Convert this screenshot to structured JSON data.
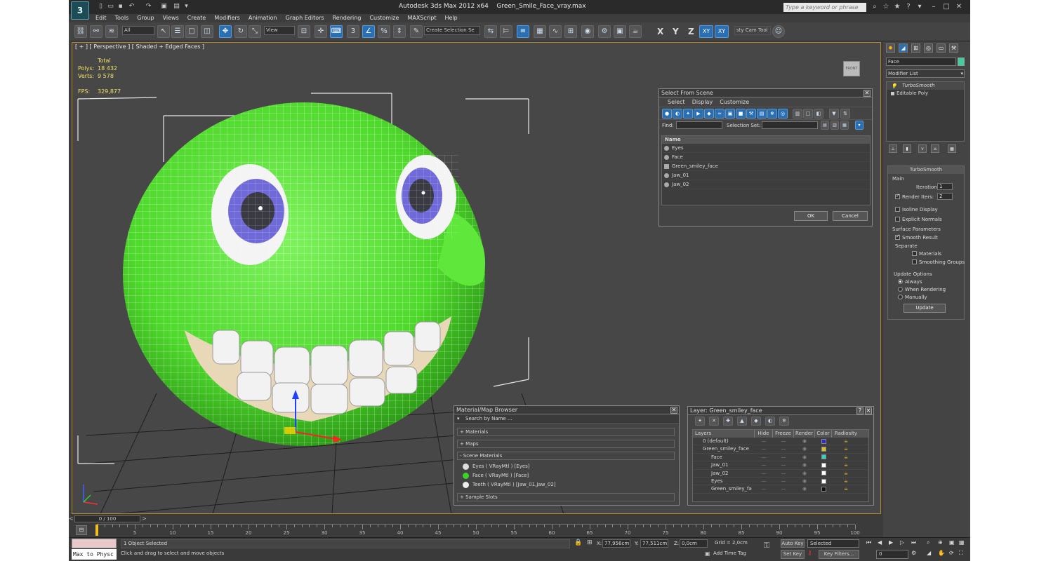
{
  "app": {
    "title": "Autodesk 3ds Max  2012 x64",
    "file": "Green_Smile_Face_vray.max",
    "search_placeholder": "Type a keyword or phrase",
    "logo": "3ds-max-logo"
  },
  "menu": [
    "Edit",
    "Tools",
    "Group",
    "Views",
    "Create",
    "Modifiers",
    "Animation",
    "Graph Editors",
    "Rendering",
    "Customize",
    "MAXScript",
    "Help"
  ],
  "toolbar": {
    "filter_value": "All",
    "view_value": "View",
    "selection_set_placeholder": "Create Selection Se",
    "axis_x": "X",
    "axis_y": "Y",
    "axis_z": "Z",
    "axis_xy": "XY",
    "axis_xy2": "XY",
    "cam_tool": "sty Cam Tool"
  },
  "viewport": {
    "label": "[ + ] [ Perspective ] [ Shaded + Edged Faces ]",
    "stats_total": "Total",
    "polys_label": "Polys:",
    "polys_value": "18 432",
    "verts_label": "Verts:",
    "verts_value": "9 578",
    "fps_label": "FPS:",
    "fps_value": "329,877",
    "viewcube_label": "FRONT"
  },
  "select_from_scene": {
    "title": "Select From Scene",
    "menu": [
      "Select",
      "Display",
      "Customize"
    ],
    "find_label": "Find:",
    "selection_set_label": "Selection Set:",
    "column_name": "Name",
    "items": [
      "Eyes",
      "Face",
      "Green_smiley_face",
      "Jaw_01",
      "Jaw_02"
    ],
    "ok": "OK",
    "cancel": "Cancel"
  },
  "material_browser": {
    "title": "Material/Map Browser",
    "search_placeholder": "Search by Name ...",
    "groups": [
      "+ Materials",
      "+ Maps",
      "- Scene Materials"
    ],
    "scene_materials": [
      "Eyes  ( VRayMtl ) [Eyes]",
      "Face  ( VRayMtl ) [Face]",
      "Teeth  ( VRayMtl ) [Jaw_01,Jaw_02]"
    ],
    "sample_slots": "+ Sample Slots"
  },
  "layer_dialog": {
    "title": "Layer: Green_smiley_face",
    "help": "?",
    "columns": [
      "Layers",
      "Hide",
      "Freeze",
      "Render",
      "Color",
      "Radiosity"
    ],
    "rows": [
      {
        "name": "0 (default)",
        "color": "#2c2ccc"
      },
      {
        "name": "Green_smiley_face",
        "color": "#d8c020"
      },
      {
        "name": "Face",
        "color": "#2ad8c8"
      },
      {
        "name": "Jaw_01",
        "color": "#ffffff"
      },
      {
        "name": "Jaw_02",
        "color": "#ffffff"
      },
      {
        "name": "Eyes",
        "color": "#ffffff"
      },
      {
        "name": "Green_smiley_fa",
        "color": "#111111"
      }
    ]
  },
  "command_panel": {
    "object_name": "Face",
    "object_color": "#3ccfa0",
    "modifier_list": "Modifier List",
    "stack": [
      "TurboSmooth",
      "Editable Poly"
    ],
    "turbosmooth": {
      "title": "TurboSmooth",
      "main": "Main",
      "iterations_label": "Iterations:",
      "iterations_value": "1",
      "render_iters_label": "Render Iters:",
      "render_iters_value": "2",
      "isoline": "Isoline Display",
      "explicit_normals": "Explicit Normals",
      "surface_params": "Surface Parameters",
      "smooth_result": "Smooth Result",
      "separate": "Separate",
      "materials": "Materials",
      "smoothing_groups": "Smoothing Groups",
      "update_options": "Update Options",
      "always": "Always",
      "when_rendering": "When Rendering",
      "manually": "Manually",
      "update_button": "Update"
    }
  },
  "timeline": {
    "frame": "0 / 100",
    "ticks": [
      "0",
      "5",
      "10",
      "15",
      "20",
      "25",
      "30",
      "35",
      "40",
      "45",
      "50",
      "55",
      "60",
      "65",
      "70",
      "75",
      "80",
      "85",
      "90",
      "95",
      "100"
    ]
  },
  "status": {
    "script_listener": "Max to Physc",
    "selected": "1 Object Selected",
    "prompt": "Click and drag to select and move objects",
    "x_value": "77,956cm",
    "y_value": "77,511cm",
    "z_value": "0,0cm",
    "grid": "Grid = 2,0cm",
    "add_time_tag": "Add Time Tag",
    "auto_key": "Auto Key",
    "selected_dd": "Selected",
    "set_key": "Set Key",
    "key_filters": "Key Filters...",
    "frame_value": "0"
  }
}
